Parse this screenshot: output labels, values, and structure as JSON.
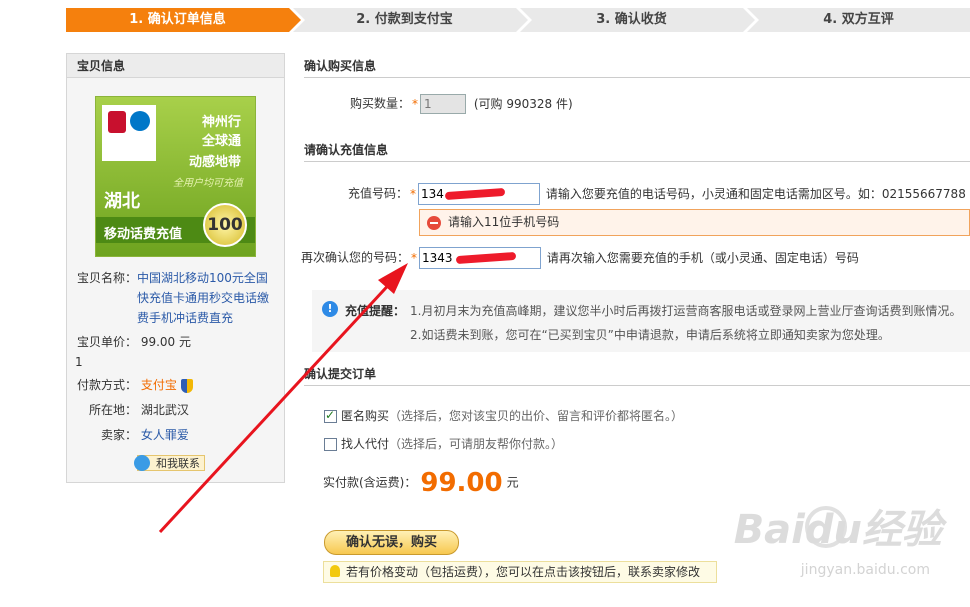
{
  "steps": [
    "1. 确认订单信息",
    "2. 付款到支付宝",
    "3. 确认收货",
    "4. 双方互评"
  ],
  "left": {
    "header": "宝贝信息",
    "card": {
      "text1": "神州行",
      "text2": "全球通",
      "text3": "动感地带",
      "text4": "全用户均可充值",
      "province": "湖北",
      "band": "移动话费充值",
      "amount": "100"
    },
    "item_name_label": "宝贝名称：",
    "item_name": "中国湖北移动100元全国快充值卡通用秒交电话缴费手机冲话费直充",
    "price_label": "宝贝单价：",
    "price": "99.00 元",
    "price_extra": "1",
    "pay_label": "付款方式：",
    "pay_method": "支付宝",
    "location_label": "所在地：",
    "location": "湖北武汉",
    "seller_label": "卖家：",
    "seller": "女人罪爱",
    "contact_btn": "和我联系"
  },
  "buy_info": {
    "title": "确认购买信息",
    "qty_label": "购买数量：",
    "qty_value": "1",
    "qty_avail": "(可购 990328 件)"
  },
  "recharge": {
    "title": "请确认充值信息",
    "phone_label": "充值号码：",
    "phone_value": "134",
    "phone_hint": "请输入您要充值的电话号码，小灵通和固定电话需加区号。如：02155667788",
    "error_msg": "请输入11位手机号码",
    "confirm_label": "再次确认您的号码：",
    "confirm_value": "1343",
    "confirm_hint": "请再次输入您需要充值的手机（或小灵通、固定电话）号码"
  },
  "tip": {
    "title": "充值提醒：",
    "line1": "1.月初月末为充值高峰期，建议您半小时后再拨打运营商客服电话或登录网上营业厅查询话费到账情况。",
    "line2": "2.如话费未到账，您可在“已买到宝贝”中申请退款，申请后系统将立即通知卖家为您处理。"
  },
  "submit": {
    "title": "确认提交订单",
    "anon_label": "匿名购买",
    "anon_desc": "（选择后，您对该宝贝的出价、留言和评价都将匿名。）",
    "proxy_label": "找人代付",
    "proxy_desc": "（选择后，可请朋友帮你付款。）",
    "total_label": "实付款(含运费)：",
    "total": "99.00",
    "total_unit": "元",
    "buy_button": "确认无误，购买",
    "note": "若有价格变动（包括运费），您可以在点击该按钮后，联系卖家修改"
  },
  "watermark": {
    "brand": "Baidu经验",
    "url": "jingyan.baidu.com"
  },
  "colors": {
    "accent": "#f5800d",
    "annotation": "#e8141e",
    "link": "#2b5aa8"
  }
}
